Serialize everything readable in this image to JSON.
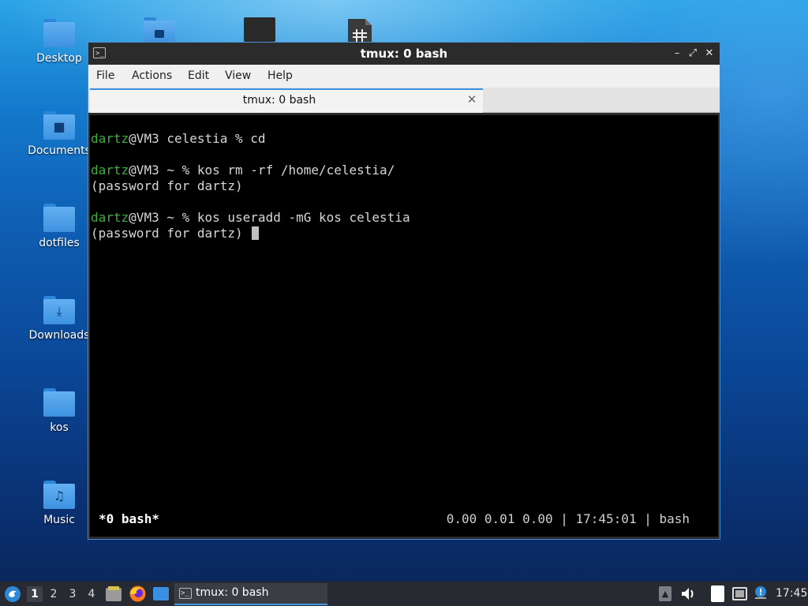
{
  "desktop": {
    "icons": [
      {
        "label": "Desktop",
        "glyph": ""
      },
      {
        "label": "Documents",
        "glyph": "■"
      },
      {
        "label": "dotfiles",
        "glyph": ""
      },
      {
        "label": "Downloads",
        "glyph": "⤓"
      },
      {
        "label": "kos",
        "glyph": ""
      },
      {
        "label": "Music",
        "glyph": "♫"
      }
    ],
    "partial_icons": [
      "pictures-folder-icon",
      "dark-file-icon",
      "spreadsheet-file-icon"
    ]
  },
  "window": {
    "title": "tmux: 0 bash",
    "app_icon": ">_",
    "controls": {
      "minimize": "–",
      "maximize": "⤢",
      "close": "✕"
    },
    "menu": [
      "File",
      "Actions",
      "Edit",
      "View",
      "Help"
    ],
    "tab": {
      "label": "tmux: 0 bash",
      "close": "✕"
    }
  },
  "terminal": {
    "lines": [
      {
        "prompt": "dartz",
        "rest": "@VM3 celestia % cd"
      },
      {
        "prompt": "dartz",
        "rest": "@VM3 ~ % kos rm -rf /home/celestia/"
      },
      {
        "prompt": "",
        "rest": "(password for dartz)"
      },
      {
        "prompt": "dartz",
        "rest": "@VM3 ~ % kos useradd -mG kos celestia"
      },
      {
        "prompt": "",
        "rest": "(password for dartz) "
      }
    ],
    "status_left": "*0 bash*",
    "status_right": "0.00 0.01 0.00 | 17:45:01 | bash",
    "prompt_color": "#3fae3f"
  },
  "taskbar": {
    "workspaces": [
      "1",
      "2",
      "3",
      "4"
    ],
    "active_workspace": "1",
    "launchers": [
      "file-manager-icon",
      "firefox-icon",
      "show-desktop-icon"
    ],
    "task_label": "tmux: 0 bash",
    "tray": [
      "upload-icon",
      "volume-icon",
      "clipboard-icon",
      "network-icon",
      "notification-icon"
    ],
    "clock": "17:45"
  }
}
